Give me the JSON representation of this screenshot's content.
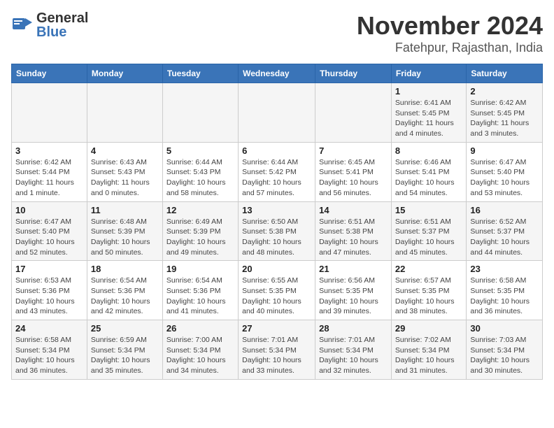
{
  "header": {
    "logo_line1": "General",
    "logo_line2": "Blue",
    "month": "November 2024",
    "location": "Fatehpur, Rajasthan, India"
  },
  "days_of_week": [
    "Sunday",
    "Monday",
    "Tuesday",
    "Wednesday",
    "Thursday",
    "Friday",
    "Saturday"
  ],
  "weeks": [
    [
      {
        "day": "",
        "info": ""
      },
      {
        "day": "",
        "info": ""
      },
      {
        "day": "",
        "info": ""
      },
      {
        "day": "",
        "info": ""
      },
      {
        "day": "",
        "info": ""
      },
      {
        "day": "1",
        "info": "Sunrise: 6:41 AM\nSunset: 5:45 PM\nDaylight: 11 hours\nand 4 minutes."
      },
      {
        "day": "2",
        "info": "Sunrise: 6:42 AM\nSunset: 5:45 PM\nDaylight: 11 hours\nand 3 minutes."
      }
    ],
    [
      {
        "day": "3",
        "info": "Sunrise: 6:42 AM\nSunset: 5:44 PM\nDaylight: 11 hours\nand 1 minute."
      },
      {
        "day": "4",
        "info": "Sunrise: 6:43 AM\nSunset: 5:43 PM\nDaylight: 11 hours\nand 0 minutes."
      },
      {
        "day": "5",
        "info": "Sunrise: 6:44 AM\nSunset: 5:43 PM\nDaylight: 10 hours\nand 58 minutes."
      },
      {
        "day": "6",
        "info": "Sunrise: 6:44 AM\nSunset: 5:42 PM\nDaylight: 10 hours\nand 57 minutes."
      },
      {
        "day": "7",
        "info": "Sunrise: 6:45 AM\nSunset: 5:41 PM\nDaylight: 10 hours\nand 56 minutes."
      },
      {
        "day": "8",
        "info": "Sunrise: 6:46 AM\nSunset: 5:41 PM\nDaylight: 10 hours\nand 54 minutes."
      },
      {
        "day": "9",
        "info": "Sunrise: 6:47 AM\nSunset: 5:40 PM\nDaylight: 10 hours\nand 53 minutes."
      }
    ],
    [
      {
        "day": "10",
        "info": "Sunrise: 6:47 AM\nSunset: 5:40 PM\nDaylight: 10 hours\nand 52 minutes."
      },
      {
        "day": "11",
        "info": "Sunrise: 6:48 AM\nSunset: 5:39 PM\nDaylight: 10 hours\nand 50 minutes."
      },
      {
        "day": "12",
        "info": "Sunrise: 6:49 AM\nSunset: 5:39 PM\nDaylight: 10 hours\nand 49 minutes."
      },
      {
        "day": "13",
        "info": "Sunrise: 6:50 AM\nSunset: 5:38 PM\nDaylight: 10 hours\nand 48 minutes."
      },
      {
        "day": "14",
        "info": "Sunrise: 6:51 AM\nSunset: 5:38 PM\nDaylight: 10 hours\nand 47 minutes."
      },
      {
        "day": "15",
        "info": "Sunrise: 6:51 AM\nSunset: 5:37 PM\nDaylight: 10 hours\nand 45 minutes."
      },
      {
        "day": "16",
        "info": "Sunrise: 6:52 AM\nSunset: 5:37 PM\nDaylight: 10 hours\nand 44 minutes."
      }
    ],
    [
      {
        "day": "17",
        "info": "Sunrise: 6:53 AM\nSunset: 5:36 PM\nDaylight: 10 hours\nand 43 minutes."
      },
      {
        "day": "18",
        "info": "Sunrise: 6:54 AM\nSunset: 5:36 PM\nDaylight: 10 hours\nand 42 minutes."
      },
      {
        "day": "19",
        "info": "Sunrise: 6:54 AM\nSunset: 5:36 PM\nDaylight: 10 hours\nand 41 minutes."
      },
      {
        "day": "20",
        "info": "Sunrise: 6:55 AM\nSunset: 5:35 PM\nDaylight: 10 hours\nand 40 minutes."
      },
      {
        "day": "21",
        "info": "Sunrise: 6:56 AM\nSunset: 5:35 PM\nDaylight: 10 hours\nand 39 minutes."
      },
      {
        "day": "22",
        "info": "Sunrise: 6:57 AM\nSunset: 5:35 PM\nDaylight: 10 hours\nand 38 minutes."
      },
      {
        "day": "23",
        "info": "Sunrise: 6:58 AM\nSunset: 5:35 PM\nDaylight: 10 hours\nand 36 minutes."
      }
    ],
    [
      {
        "day": "24",
        "info": "Sunrise: 6:58 AM\nSunset: 5:34 PM\nDaylight: 10 hours\nand 36 minutes."
      },
      {
        "day": "25",
        "info": "Sunrise: 6:59 AM\nSunset: 5:34 PM\nDaylight: 10 hours\nand 35 minutes."
      },
      {
        "day": "26",
        "info": "Sunrise: 7:00 AM\nSunset: 5:34 PM\nDaylight: 10 hours\nand 34 minutes."
      },
      {
        "day": "27",
        "info": "Sunrise: 7:01 AM\nSunset: 5:34 PM\nDaylight: 10 hours\nand 33 minutes."
      },
      {
        "day": "28",
        "info": "Sunrise: 7:01 AM\nSunset: 5:34 PM\nDaylight: 10 hours\nand 32 minutes."
      },
      {
        "day": "29",
        "info": "Sunrise: 7:02 AM\nSunset: 5:34 PM\nDaylight: 10 hours\nand 31 minutes."
      },
      {
        "day": "30",
        "info": "Sunrise: 7:03 AM\nSunset: 5:34 PM\nDaylight: 10 hours\nand 30 minutes."
      }
    ]
  ]
}
